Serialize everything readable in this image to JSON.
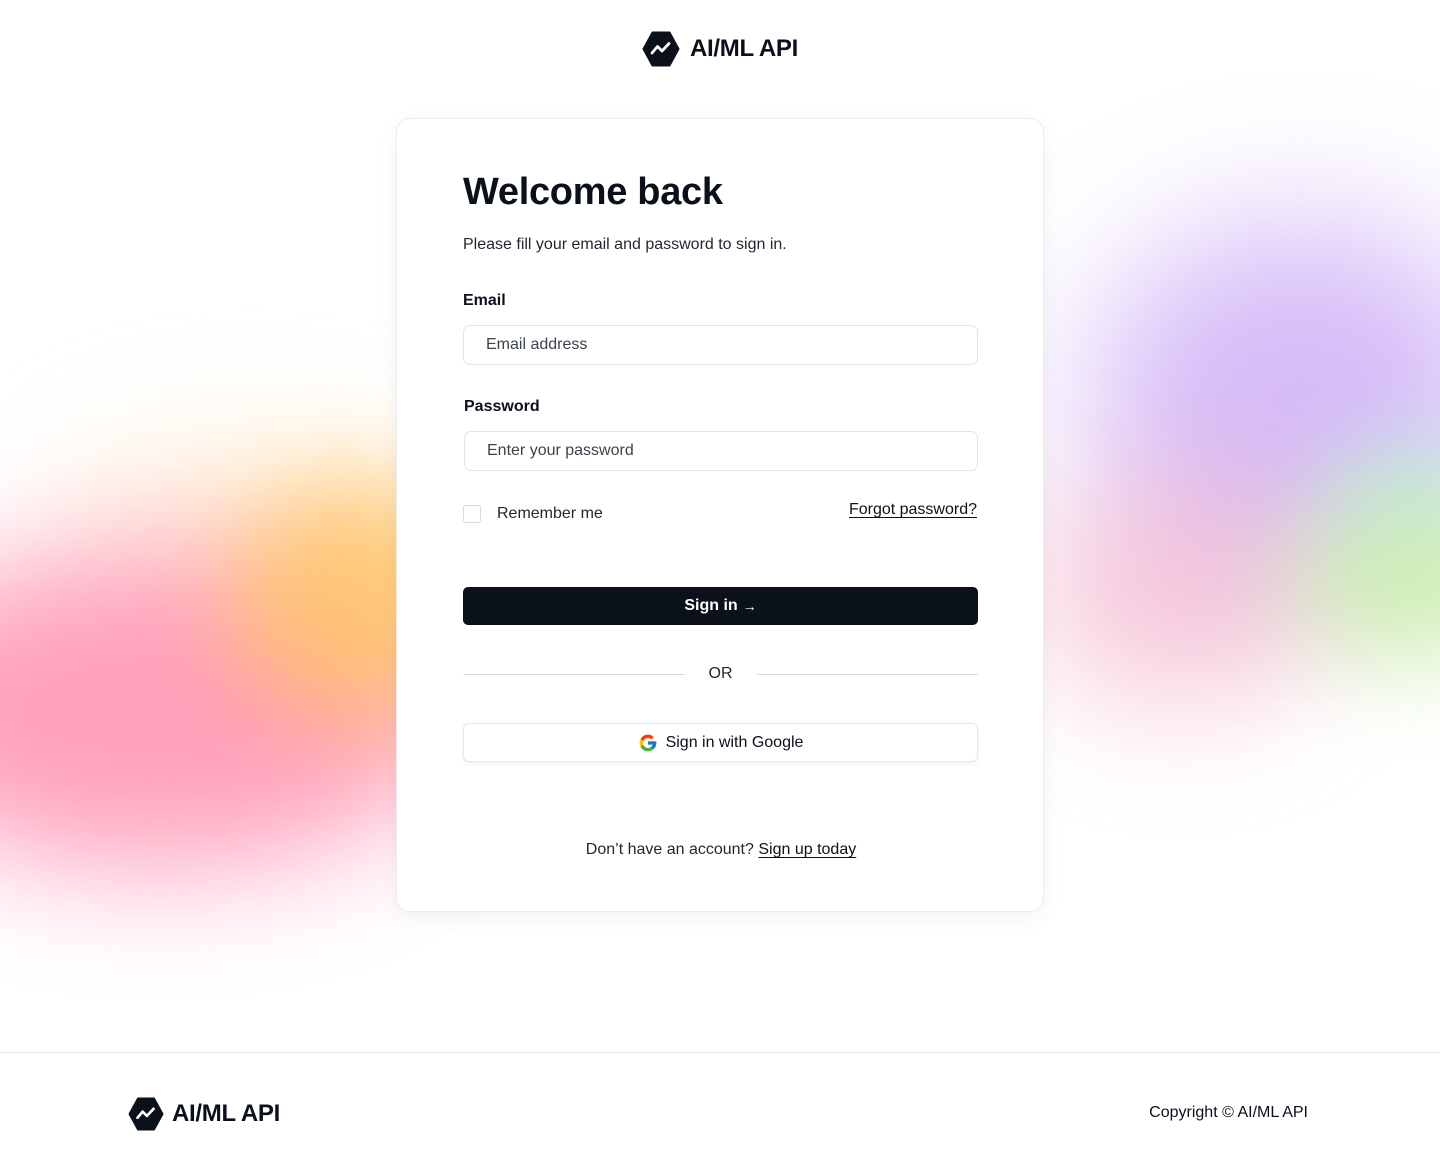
{
  "brand": {
    "name": "AI/ML API",
    "logo_icon": "hexagon-trend-icon"
  },
  "login": {
    "title": "Welcome back",
    "subtitle": "Please fill your email and password to sign in.",
    "email_label": "Email",
    "email_placeholder": "Email address",
    "email_value": "",
    "password_label": "Password",
    "password_placeholder": "Enter your password",
    "password_value": "",
    "remember_label": "Remember me",
    "remember_checked": false,
    "forgot_label": "Forgot password?",
    "signin_label": "Sign in",
    "signin_arrow": "→",
    "or_label": "OR",
    "google_label": "Sign in with Google",
    "no_account_text": "Don’t have an account?",
    "signup_label": "Sign up today"
  },
  "footer": {
    "brand_name": "AI/ML API",
    "copyright": "Copyright © AI/ML API"
  },
  "colors": {
    "primary": "#0b111b",
    "background": "#ffffff",
    "border": "#e3e4e8"
  }
}
